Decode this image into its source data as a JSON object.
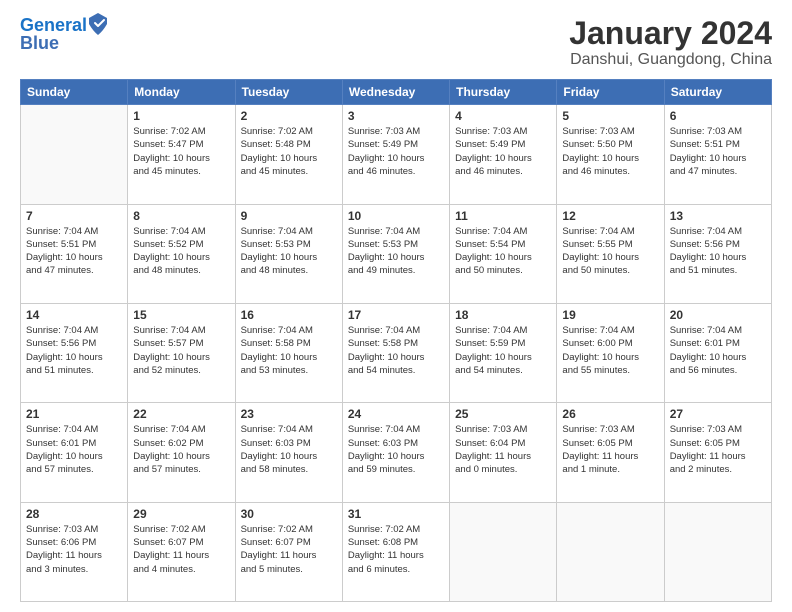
{
  "logo": {
    "line1": "General",
    "line2": "Blue"
  },
  "title": "January 2024",
  "subtitle": "Danshui, Guangdong, China",
  "days_header": [
    "Sunday",
    "Monday",
    "Tuesday",
    "Wednesday",
    "Thursday",
    "Friday",
    "Saturday"
  ],
  "weeks": [
    [
      {
        "day": "",
        "info": ""
      },
      {
        "day": "1",
        "info": "Sunrise: 7:02 AM\nSunset: 5:47 PM\nDaylight: 10 hours\nand 45 minutes."
      },
      {
        "day": "2",
        "info": "Sunrise: 7:02 AM\nSunset: 5:48 PM\nDaylight: 10 hours\nand 45 minutes."
      },
      {
        "day": "3",
        "info": "Sunrise: 7:03 AM\nSunset: 5:49 PM\nDaylight: 10 hours\nand 46 minutes."
      },
      {
        "day": "4",
        "info": "Sunrise: 7:03 AM\nSunset: 5:49 PM\nDaylight: 10 hours\nand 46 minutes."
      },
      {
        "day": "5",
        "info": "Sunrise: 7:03 AM\nSunset: 5:50 PM\nDaylight: 10 hours\nand 46 minutes."
      },
      {
        "day": "6",
        "info": "Sunrise: 7:03 AM\nSunset: 5:51 PM\nDaylight: 10 hours\nand 47 minutes."
      }
    ],
    [
      {
        "day": "7",
        "info": "Sunrise: 7:04 AM\nSunset: 5:51 PM\nDaylight: 10 hours\nand 47 minutes."
      },
      {
        "day": "8",
        "info": "Sunrise: 7:04 AM\nSunset: 5:52 PM\nDaylight: 10 hours\nand 48 minutes."
      },
      {
        "day": "9",
        "info": "Sunrise: 7:04 AM\nSunset: 5:53 PM\nDaylight: 10 hours\nand 48 minutes."
      },
      {
        "day": "10",
        "info": "Sunrise: 7:04 AM\nSunset: 5:53 PM\nDaylight: 10 hours\nand 49 minutes."
      },
      {
        "day": "11",
        "info": "Sunrise: 7:04 AM\nSunset: 5:54 PM\nDaylight: 10 hours\nand 50 minutes."
      },
      {
        "day": "12",
        "info": "Sunrise: 7:04 AM\nSunset: 5:55 PM\nDaylight: 10 hours\nand 50 minutes."
      },
      {
        "day": "13",
        "info": "Sunrise: 7:04 AM\nSunset: 5:56 PM\nDaylight: 10 hours\nand 51 minutes."
      }
    ],
    [
      {
        "day": "14",
        "info": "Sunrise: 7:04 AM\nSunset: 5:56 PM\nDaylight: 10 hours\nand 51 minutes."
      },
      {
        "day": "15",
        "info": "Sunrise: 7:04 AM\nSunset: 5:57 PM\nDaylight: 10 hours\nand 52 minutes."
      },
      {
        "day": "16",
        "info": "Sunrise: 7:04 AM\nSunset: 5:58 PM\nDaylight: 10 hours\nand 53 minutes."
      },
      {
        "day": "17",
        "info": "Sunrise: 7:04 AM\nSunset: 5:58 PM\nDaylight: 10 hours\nand 54 minutes."
      },
      {
        "day": "18",
        "info": "Sunrise: 7:04 AM\nSunset: 5:59 PM\nDaylight: 10 hours\nand 54 minutes."
      },
      {
        "day": "19",
        "info": "Sunrise: 7:04 AM\nSunset: 6:00 PM\nDaylight: 10 hours\nand 55 minutes."
      },
      {
        "day": "20",
        "info": "Sunrise: 7:04 AM\nSunset: 6:01 PM\nDaylight: 10 hours\nand 56 minutes."
      }
    ],
    [
      {
        "day": "21",
        "info": "Sunrise: 7:04 AM\nSunset: 6:01 PM\nDaylight: 10 hours\nand 57 minutes."
      },
      {
        "day": "22",
        "info": "Sunrise: 7:04 AM\nSunset: 6:02 PM\nDaylight: 10 hours\nand 57 minutes."
      },
      {
        "day": "23",
        "info": "Sunrise: 7:04 AM\nSunset: 6:03 PM\nDaylight: 10 hours\nand 58 minutes."
      },
      {
        "day": "24",
        "info": "Sunrise: 7:04 AM\nSunset: 6:03 PM\nDaylight: 10 hours\nand 59 minutes."
      },
      {
        "day": "25",
        "info": "Sunrise: 7:03 AM\nSunset: 6:04 PM\nDaylight: 11 hours\nand 0 minutes."
      },
      {
        "day": "26",
        "info": "Sunrise: 7:03 AM\nSunset: 6:05 PM\nDaylight: 11 hours\nand 1 minute."
      },
      {
        "day": "27",
        "info": "Sunrise: 7:03 AM\nSunset: 6:05 PM\nDaylight: 11 hours\nand 2 minutes."
      }
    ],
    [
      {
        "day": "28",
        "info": "Sunrise: 7:03 AM\nSunset: 6:06 PM\nDaylight: 11 hours\nand 3 minutes."
      },
      {
        "day": "29",
        "info": "Sunrise: 7:02 AM\nSunset: 6:07 PM\nDaylight: 11 hours\nand 4 minutes."
      },
      {
        "day": "30",
        "info": "Sunrise: 7:02 AM\nSunset: 6:07 PM\nDaylight: 11 hours\nand 5 minutes."
      },
      {
        "day": "31",
        "info": "Sunrise: 7:02 AM\nSunset: 6:08 PM\nDaylight: 11 hours\nand 6 minutes."
      },
      {
        "day": "",
        "info": ""
      },
      {
        "day": "",
        "info": ""
      },
      {
        "day": "",
        "info": ""
      }
    ]
  ]
}
